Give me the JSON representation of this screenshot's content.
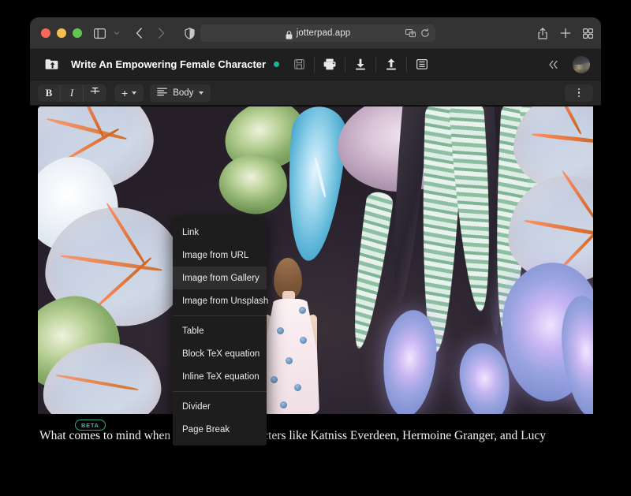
{
  "browser": {
    "url": "jotterpad.app",
    "lock_icon": "lock-icon",
    "nav": {
      "sidebar_toggle": "sidebar-toggle-icon",
      "tab_overview_caret": "chevron-down-icon",
      "back": "chevron-left-icon",
      "forward": "chevron-right-icon",
      "reader_shield": "privacy-shield-icon",
      "translate": "translate-icon",
      "reload": "reload-icon",
      "share": "share-icon",
      "new_tab": "plus-icon",
      "tab_grid": "tab-overview-icon"
    }
  },
  "app_header": {
    "folder_icon": "folder-home-icon",
    "document_title": "Write An Empowering Female Character",
    "sync_status_color": "#18b79a",
    "save_icon": "save-icon",
    "print_icon": "print-icon",
    "download_icon": "download-icon",
    "upload_icon": "upload-icon",
    "outline_icon": "outline-list-icon",
    "collapse_icon": "chevron-double-left-icon",
    "avatar": "user-avatar"
  },
  "format_toolbar": {
    "bold_label": "B",
    "italic_label": "I",
    "strikethrough_label": "strikethrough-icon",
    "insert_label": "+",
    "paragraph_style_label": "Body",
    "more_label": "kebab-menu-icon"
  },
  "insert_menu": {
    "groups": [
      {
        "items": [
          {
            "label": "Link",
            "highlighted": false
          },
          {
            "label": "Image from URL",
            "highlighted": false
          },
          {
            "label": "Image from Gallery",
            "highlighted": true
          },
          {
            "label": "Image from Unsplash",
            "highlighted": false
          }
        ]
      },
      {
        "items": [
          {
            "label": "Table",
            "highlighted": false
          },
          {
            "label": "Block TeX equation",
            "highlighted": false
          },
          {
            "label": "Inline TeX equation",
            "highlighted": false
          }
        ]
      },
      {
        "items": [
          {
            "label": "Divider",
            "highlighted": false
          },
          {
            "label": "Page Break",
            "highlighted": false
          }
        ]
      }
    ]
  },
  "editor": {
    "hero_image_alt": "Illustration of a girl in a white floral dress standing among oversized tropical caladium and calathea leaves on a dark background",
    "beta_badge": "BETA",
    "body_text": "What comes to mind when you think of characters like Katniss Everdeen, Hermoine Granger, and Lucy"
  },
  "colors": {
    "accent_teal": "#2fc0a8",
    "window_chrome": "#333333",
    "app_background": "#1f1f1f",
    "toolbar_background": "#262626",
    "menu_background": "#1d1d1d",
    "menu_highlight": "#2e2e2e"
  }
}
